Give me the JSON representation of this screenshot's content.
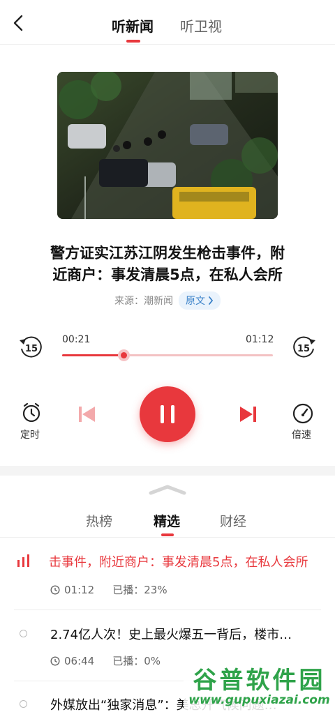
{
  "header": {
    "tabs": [
      {
        "label": "听新闻",
        "active": true
      },
      {
        "label": "听卫视",
        "active": false
      }
    ]
  },
  "article": {
    "title_line1": "警方证实江苏江阴发生枪击事件，附",
    "title_line2": "近商户：事发清晨5点，在私人会所",
    "source": "来源：潮新闻",
    "original_label": "原文"
  },
  "player": {
    "current_time": "00:21",
    "total_time": "01:12",
    "progress": 0.29,
    "back_skip": "15",
    "forward_skip": "15",
    "timer_label": "定时",
    "speed_label": "倍速",
    "state": "playing"
  },
  "list_tabs": [
    {
      "label": "热榜",
      "active": false
    },
    {
      "label": "精选",
      "active": true
    },
    {
      "label": "财经",
      "active": false
    }
  ],
  "list": {
    "items": [
      {
        "title": "击事件，附近商户：事发清晨5点，在私人会所",
        "duration": "01:12",
        "played": "已播：23%",
        "playing": true
      },
      {
        "title": "2.74亿人次！史上最火爆五一背后，楼市…",
        "duration": "06:44",
        "played": "已播：0%",
        "playing": false
      },
      {
        "title": "外媒放出“独家消息”：美总开气候问题…",
        "playing": false
      }
    ]
  },
  "watermark": {
    "top": "谷普软件园",
    "bottom": "www.gupuxiazai.com"
  },
  "colors": {
    "accent": "#e8383d",
    "link": "#3b82c9",
    "watermark": "#2fa34a"
  }
}
